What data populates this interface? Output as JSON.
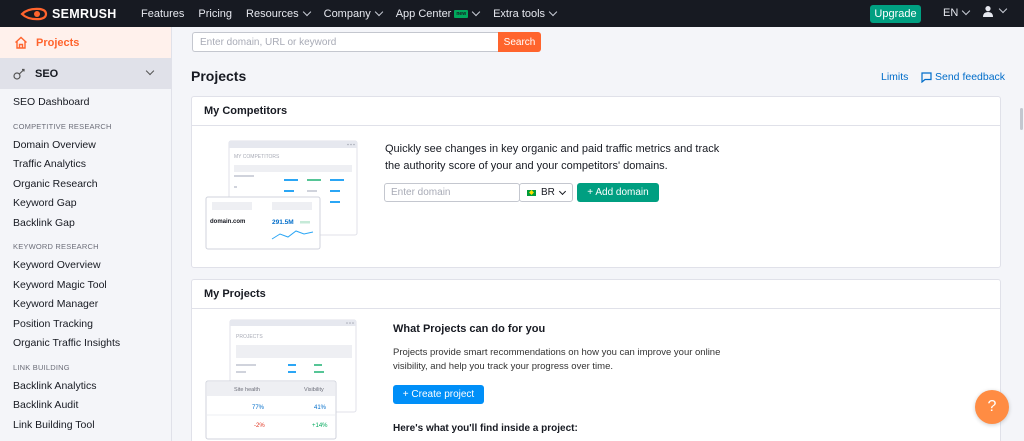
{
  "brand": {
    "name": "SEMRUSH",
    "accent": "#FF642D",
    "dark": "#171A22"
  },
  "topnav": {
    "items": [
      {
        "label": "Features",
        "caret": false
      },
      {
        "label": "Pricing",
        "caret": false
      },
      {
        "label": "Resources",
        "caret": true
      },
      {
        "label": "Company",
        "caret": true
      },
      {
        "label": "App Center",
        "caret": true,
        "badge": "new"
      },
      {
        "label": "Extra tools",
        "caret": true
      }
    ],
    "upgrade_label": "Upgrade",
    "language": "EN"
  },
  "search": {
    "placeholder": "Enter domain, URL or keyword",
    "button_label": "Search"
  },
  "sidebar": {
    "projects_label": "Projects",
    "section_label": "SEO",
    "entries": [
      {
        "type": "link",
        "label": "SEO Dashboard"
      },
      {
        "type": "spacer"
      },
      {
        "type": "head",
        "label": "COMPETITIVE RESEARCH"
      },
      {
        "type": "link",
        "label": "Domain Overview"
      },
      {
        "type": "link",
        "label": "Traffic Analytics"
      },
      {
        "type": "link",
        "label": "Organic Research"
      },
      {
        "type": "link",
        "label": "Keyword Gap"
      },
      {
        "type": "link",
        "label": "Backlink Gap"
      },
      {
        "type": "spacer"
      },
      {
        "type": "head",
        "label": "KEYWORD RESEARCH"
      },
      {
        "type": "link",
        "label": "Keyword Overview"
      },
      {
        "type": "link",
        "label": "Keyword Magic Tool"
      },
      {
        "type": "link",
        "label": "Keyword Manager"
      },
      {
        "type": "link",
        "label": "Position Tracking"
      },
      {
        "type": "link",
        "label": "Organic Traffic Insights"
      },
      {
        "type": "spacer"
      },
      {
        "type": "head",
        "label": "LINK BUILDING"
      },
      {
        "type": "link",
        "label": "Backlink Analytics"
      },
      {
        "type": "link",
        "label": "Backlink Audit"
      },
      {
        "type": "link",
        "label": "Link Building Tool"
      }
    ]
  },
  "main": {
    "title": "Projects",
    "limits_label": "Limits",
    "feedback_label": "Send feedback",
    "competitors": {
      "heading": "My Competitors",
      "description": "Quickly see changes in key organic and paid traffic metrics and track the authority score of your and your competitors' domains.",
      "domain_placeholder": "Enter domain",
      "country": "BR",
      "add_label": "+ Add domain",
      "illustration": {
        "panel_title": "MY COMPETITORS",
        "domain": "domain.com",
        "value": "291.5M"
      }
    },
    "projects": {
      "heading": "My Projects",
      "what_heading": "What Projects can do for you",
      "what_text": "Projects provide smart recommendations on how you can improve your online visibility, and help you track your progress over time.",
      "create_label": "+ Create project",
      "inside_heading": "Here's what you'll find inside a project:",
      "illustration": {
        "panel_title": "PROJECTS",
        "col1": "Site health",
        "col2": "Visibility",
        "rows": [
          [
            "77%",
            "41%"
          ],
          [
            "-2%",
            "+14%"
          ]
        ]
      }
    }
  },
  "help_label": "?"
}
